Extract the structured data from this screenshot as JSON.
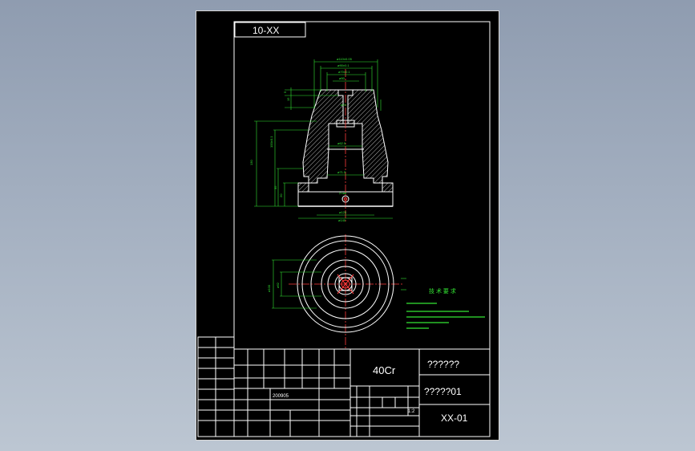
{
  "drawing": {
    "corner_code": "10-XX",
    "material": "40Cr",
    "company": "??????",
    "part_number": "?????01",
    "drawing_code": "XX-01",
    "scale": "1:2",
    "date": "200905",
    "tech_req_title": "技 术 要 求"
  },
  "colors": {
    "background": "#000000",
    "outline": "#ffffff",
    "dimension": "#33e633",
    "centerline": "#ff3b3b",
    "hatch": "#ffffff"
  }
}
